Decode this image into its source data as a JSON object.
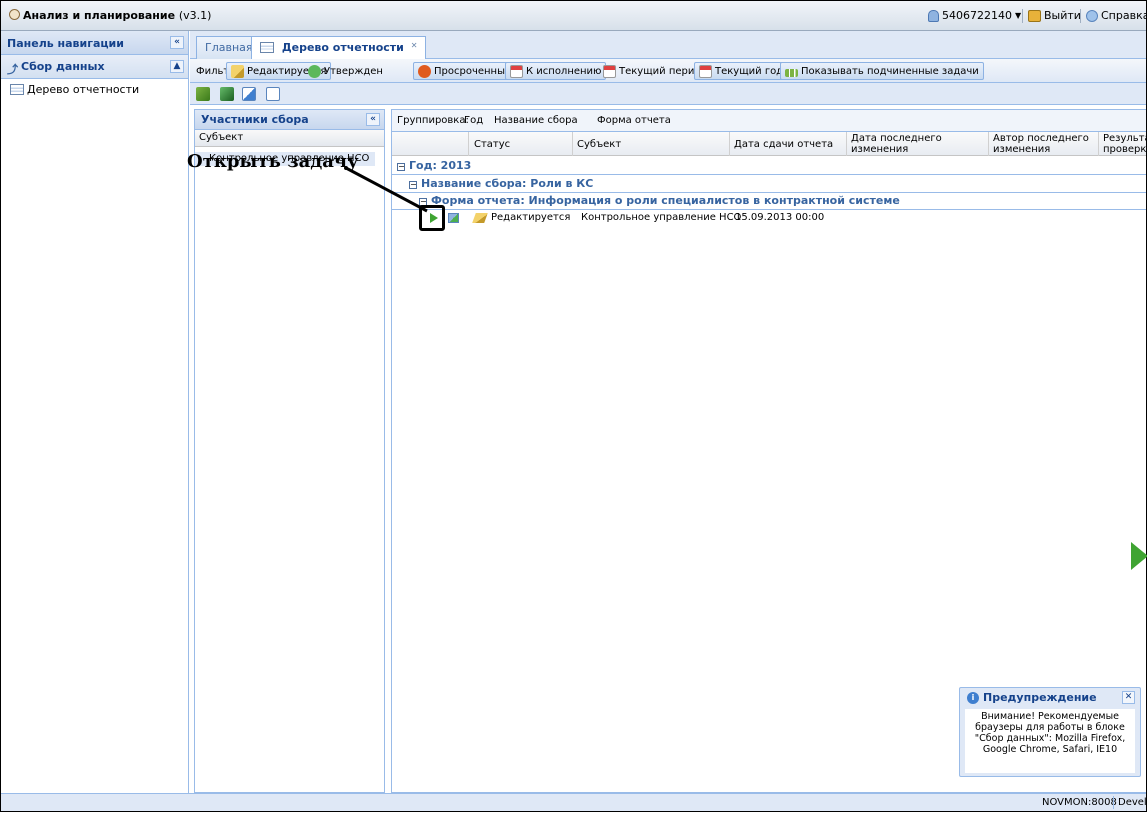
{
  "app": {
    "title": "Анализ и планирование",
    "version": "(v3.1)"
  },
  "topbar": {
    "user": "5406722140",
    "logout": "Выйти",
    "help": "Справка"
  },
  "nav": {
    "title": "Панель навигации",
    "section": "Сбор данных",
    "items": [
      {
        "label": "Дерево отчетности"
      }
    ]
  },
  "tabs": [
    {
      "label": "Главная"
    },
    {
      "label": "Дерево отчетности"
    }
  ],
  "filters": {
    "label": "Фильтры:",
    "buttons": [
      {
        "label": "Редактируется"
      },
      {
        "label": "Утвержден"
      },
      {
        "label": "Просроченные"
      },
      {
        "label": "К исполнению"
      },
      {
        "label": "Текущий период"
      },
      {
        "label": "Текущий год"
      },
      {
        "label": "Показывать подчиненные задачи"
      }
    ]
  },
  "participants": {
    "title": "Участники сбора",
    "column": "Субъект",
    "rows": [
      "Контрольное управление НСО"
    ]
  },
  "grid": {
    "grouping_label": "Группировка:",
    "grouping": [
      "Год",
      "Название сбора",
      "Форма отчета"
    ],
    "columns": [
      "Статус",
      "Субъект",
      "Дата сдачи отчета",
      "Дата последнего изменения",
      "Автор последнего изменения",
      "Результа проверки"
    ],
    "groups": [
      "Год: 2013",
      "Название сбора: Роли в КС",
      "Форма отчета: Информация о роли специалистов в контрактной системе"
    ],
    "row": {
      "status": "Редактируется",
      "subject": "Контрольное управление НСО",
      "date": "15.09.2013 00:00"
    }
  },
  "annotation": {
    "callout": "Открыть задачу"
  },
  "warning": {
    "title": "Предупреждение",
    "body": "Внимание! Рекомендуемые браузеры для работы в блоке \"Сбор данных\": Mozilla Firefox, Google Chrome, Safari, IE10"
  },
  "status": {
    "server": "NOVMON:8008",
    "mode": "Develo"
  },
  "colors": {
    "header_blue": "#15428b",
    "panel_bg": "#dfe8f6",
    "border": "#99bbe8",
    "play_green": "#3fa432"
  }
}
